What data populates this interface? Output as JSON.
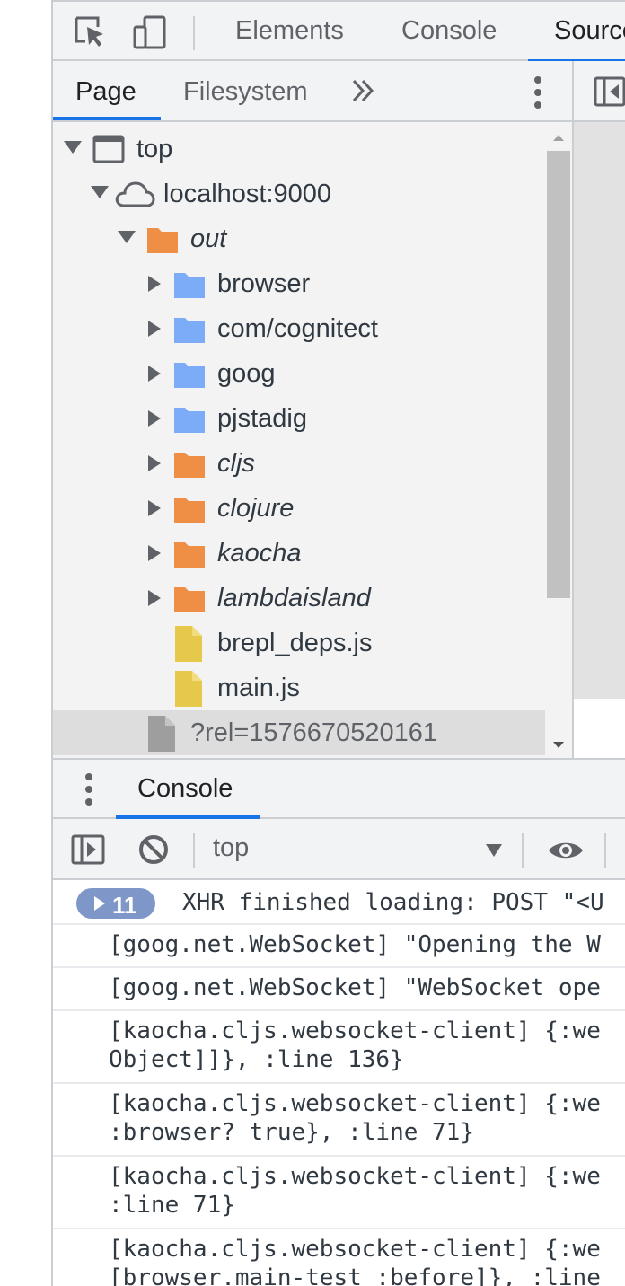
{
  "main_tabs": {
    "elements": "Elements",
    "console": "Console",
    "sources": "Sources"
  },
  "navigator": {
    "tabs": {
      "page": "Page",
      "filesystem": "Filesystem"
    },
    "tree": [
      {
        "label": "top",
        "kind": "frame",
        "expanded": true
      },
      {
        "label": "localhost:9000",
        "kind": "cloud",
        "expanded": true
      },
      {
        "label": "out",
        "kind": "folder-orange",
        "expanded": true,
        "italic": true
      },
      {
        "label": "browser",
        "kind": "folder-blue"
      },
      {
        "label": "com/cognitect",
        "kind": "folder-blue"
      },
      {
        "label": "goog",
        "kind": "folder-blue"
      },
      {
        "label": "pjstadig",
        "kind": "folder-blue"
      },
      {
        "label": "cljs",
        "kind": "folder-orange",
        "italic": true
      },
      {
        "label": "clojure",
        "kind": "folder-orange",
        "italic": true
      },
      {
        "label": "kaocha",
        "kind": "folder-orange",
        "italic": true
      },
      {
        "label": "lambdaisland",
        "kind": "folder-orange",
        "italic": true
      },
      {
        "label": "brepl_deps.js",
        "kind": "file-js"
      },
      {
        "label": "main.js",
        "kind": "file-js"
      },
      {
        "label": "?rel=1576670520161",
        "kind": "file-gray",
        "selected": true
      }
    ]
  },
  "drawer": {
    "tab": "Console",
    "context": "top"
  },
  "console": {
    "messages": [
      {
        "count": "11",
        "text": "XHR finished loading: POST \"<U"
      },
      {
        "text": "[goog.net.WebSocket] \"Opening the W"
      },
      {
        "text": "[goog.net.WebSocket] \"WebSocket ope"
      },
      {
        "text": "[kaocha.cljs.websocket-client] {:we",
        "text2": "Object]]}, :line 136}"
      },
      {
        "text": "[kaocha.cljs.websocket-client] {:we",
        "text2": ":browser? true}, :line 71}"
      },
      {
        "text": "[kaocha.cljs.websocket-client] {:we",
        "text2": ":line 71}"
      },
      {
        "text": "[kaocha.cljs.websocket-client] {:we",
        "text2": "[browser.main-test :before]}, :line"
      }
    ]
  },
  "colors": {
    "accent": "#1a73e8",
    "folder_blue": "#7cacf8",
    "folder_orange": "#ef8f45",
    "file_js": "#e6c84b",
    "badge": "#7e97c8"
  }
}
